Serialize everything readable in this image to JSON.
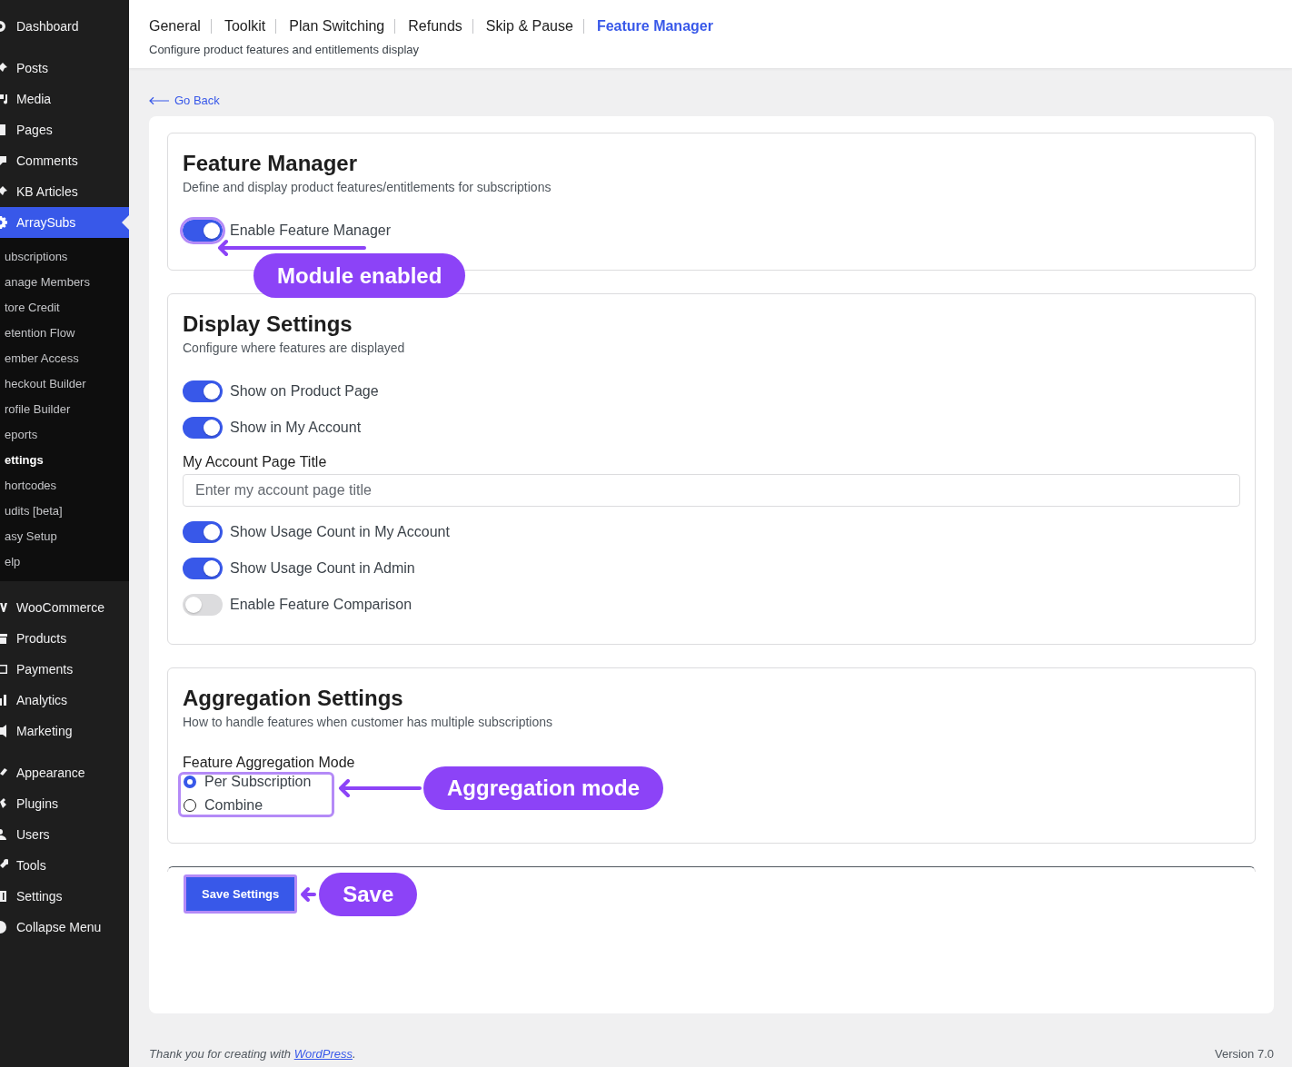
{
  "sidebar": {
    "groups": [
      {
        "items": [
          {
            "label": "Dashboard",
            "selected": false
          }
        ]
      },
      {
        "items": [
          {
            "label": "Posts",
            "selected": false
          },
          {
            "label": "Media",
            "selected": false
          },
          {
            "label": "Pages",
            "selected": false
          },
          {
            "label": "Comments",
            "selected": false
          },
          {
            "label": "KB Articles",
            "selected": false
          },
          {
            "label": "ArraySubs",
            "selected": true,
            "children": [
              {
                "label": "ubscriptions",
                "selected": false
              },
              {
                "label": "anage Members",
                "selected": false
              },
              {
                "label": "tore Credit",
                "selected": false
              },
              {
                "label": "etention Flow",
                "selected": false
              },
              {
                "label": "ember Access",
                "selected": false
              },
              {
                "label": "heckout Builder",
                "selected": false
              },
              {
                "label": "rofile Builder",
                "selected": false
              },
              {
                "label": "eports",
                "selected": false
              },
              {
                "label": "ettings",
                "selected": true
              },
              {
                "label": "hortcodes",
                "selected": false
              },
              {
                "label": "udits [beta]",
                "selected": false
              },
              {
                "label": "asy Setup",
                "selected": false
              },
              {
                "label": "elp",
                "selected": false
              }
            ]
          }
        ]
      },
      {
        "items": [
          {
            "label": "WooCommerce",
            "selected": false
          },
          {
            "label": "Products",
            "selected": false
          },
          {
            "label": "Payments",
            "selected": false
          },
          {
            "label": "Analytics",
            "selected": false
          },
          {
            "label": "Marketing",
            "selected": false
          }
        ]
      },
      {
        "items": [
          {
            "label": "Appearance",
            "selected": false
          },
          {
            "label": "Plugins",
            "selected": false
          },
          {
            "label": "Users",
            "selected": false
          },
          {
            "label": "Tools",
            "selected": false
          },
          {
            "label": "Settings",
            "selected": false
          },
          {
            "label": "Collapse Menu",
            "selected": false
          }
        ]
      }
    ]
  },
  "header": {
    "tabs": [
      {
        "label": "General",
        "selected": false
      },
      {
        "label": "Toolkit",
        "selected": false
      },
      {
        "label": "Plan Switching",
        "selected": false
      },
      {
        "label": "Refunds",
        "selected": false
      },
      {
        "label": "Skip & Pause",
        "selected": false
      },
      {
        "label": "Feature Manager",
        "selected": true
      }
    ],
    "subtitle": "Configure product features and entitlements display"
  },
  "go_back": {
    "label": "Go Back"
  },
  "sections": [
    {
      "title": "Feature Manager",
      "subtitle": "Define and display product features/entitlements for subscriptions",
      "fields": [
        {
          "kind": "toggle",
          "label": "Enable Feature Manager",
          "on": true,
          "callout": "Module enabled"
        }
      ]
    },
    {
      "title": "Display Settings",
      "subtitle": "Configure where features are displayed",
      "fields": [
        {
          "kind": "toggle",
          "label": "Show on Product Page",
          "on": true
        },
        {
          "kind": "toggle",
          "label": "Show in My Account",
          "on": true
        },
        {
          "kind": "text",
          "label": "My Account Page Title",
          "placeholder": "Enter my account page title"
        },
        {
          "kind": "toggle",
          "label": "Show Usage Count in My Account",
          "on": true
        },
        {
          "kind": "toggle",
          "label": "Show Usage Count in Admin",
          "on": true
        },
        {
          "kind": "toggle",
          "label": "Enable Feature Comparison",
          "on": false
        }
      ]
    },
    {
      "title": "Aggregation Settings",
      "subtitle": "How to handle features when customer has multiple subscriptions",
      "fields": [
        {
          "kind": "radio",
          "label": "Feature Aggregation Mode",
          "options": [
            {
              "label": "Per Subscription",
              "selected": true
            },
            {
              "label": "Combine",
              "selected": false
            }
          ],
          "callout": "Aggregation mode"
        }
      ]
    }
  ],
  "save_button": {
    "label": "Save Settings",
    "callout": "Save"
  },
  "footer": {
    "credit": "Thank you for creating with",
    "link": "WordPress",
    "end": ".",
    "version": "Version 7.0"
  }
}
